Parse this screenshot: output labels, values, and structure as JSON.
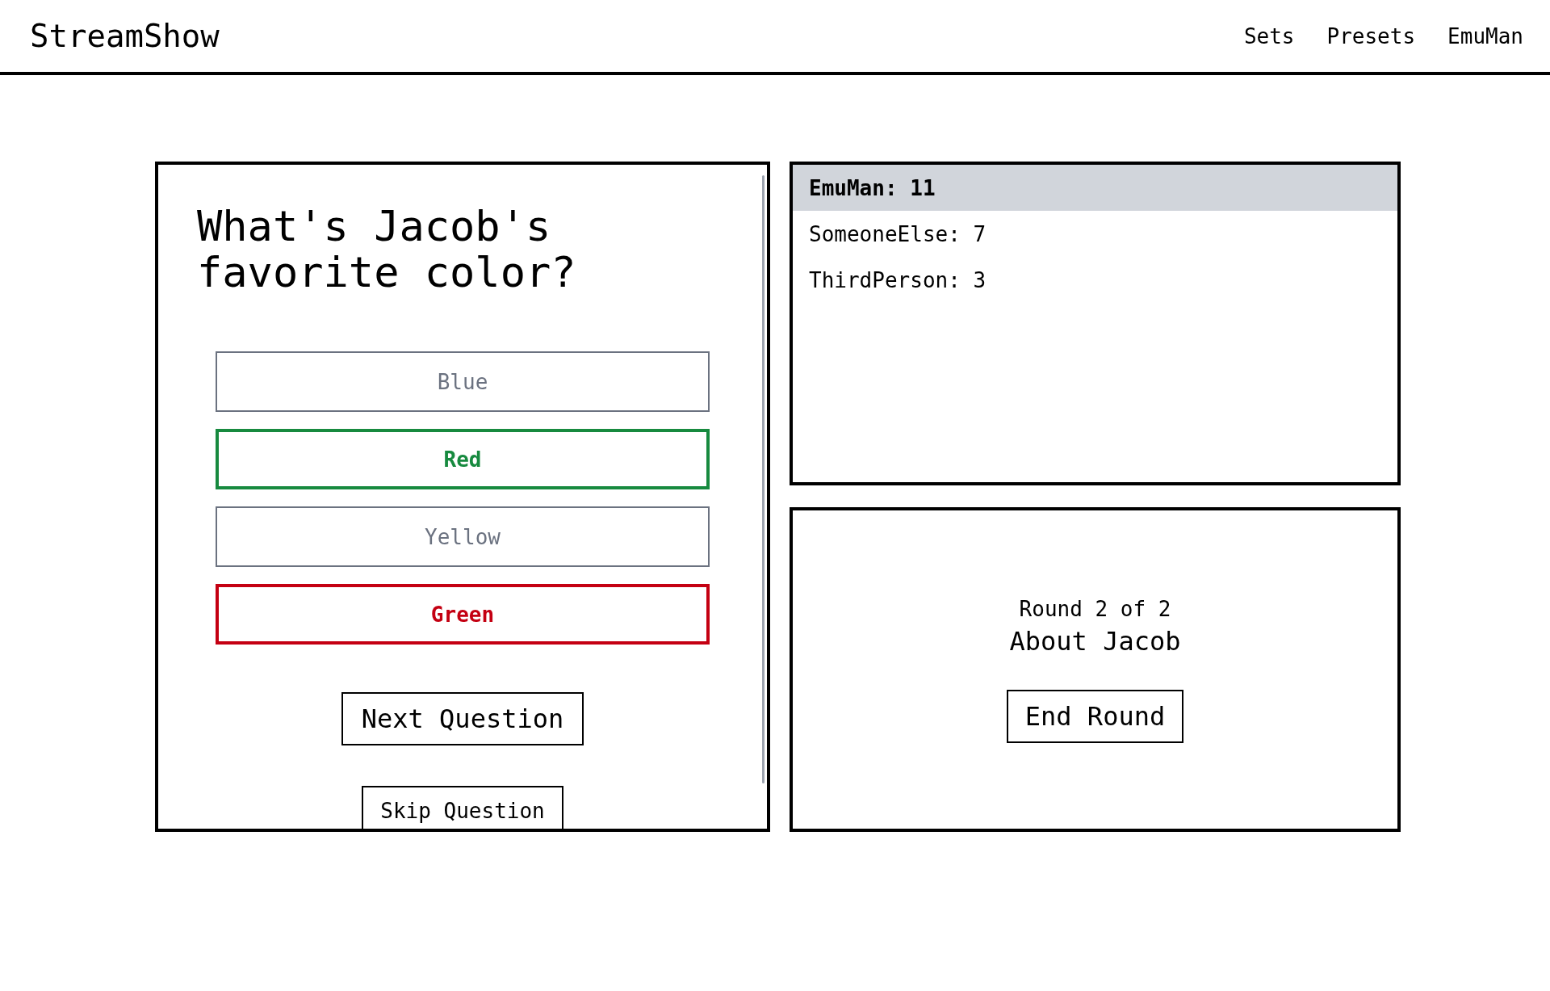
{
  "header": {
    "title": "StreamShow",
    "nav": [
      "Sets",
      "Presets",
      "EmuMan"
    ]
  },
  "question": {
    "text": "What's Jacob's favorite color?",
    "answers": [
      {
        "label": "Blue",
        "correct": false,
        "wrong": false
      },
      {
        "label": "Red",
        "correct": true,
        "wrong": false
      },
      {
        "label": "Yellow",
        "correct": false,
        "wrong": false
      },
      {
        "label": "Green",
        "correct": false,
        "wrong": true
      }
    ],
    "next_button": "Next Question",
    "skip_button": "Skip Question"
  },
  "scoreboard": {
    "players": [
      {
        "label": "EmuMan: 11",
        "highlighted": true
      },
      {
        "label": "SomeoneElse: 7",
        "highlighted": false
      },
      {
        "label": "ThirdPerson: 3",
        "highlighted": false
      }
    ]
  },
  "round": {
    "counter": "Round 2 of 2",
    "title": "About Jacob",
    "button": "End Round"
  }
}
